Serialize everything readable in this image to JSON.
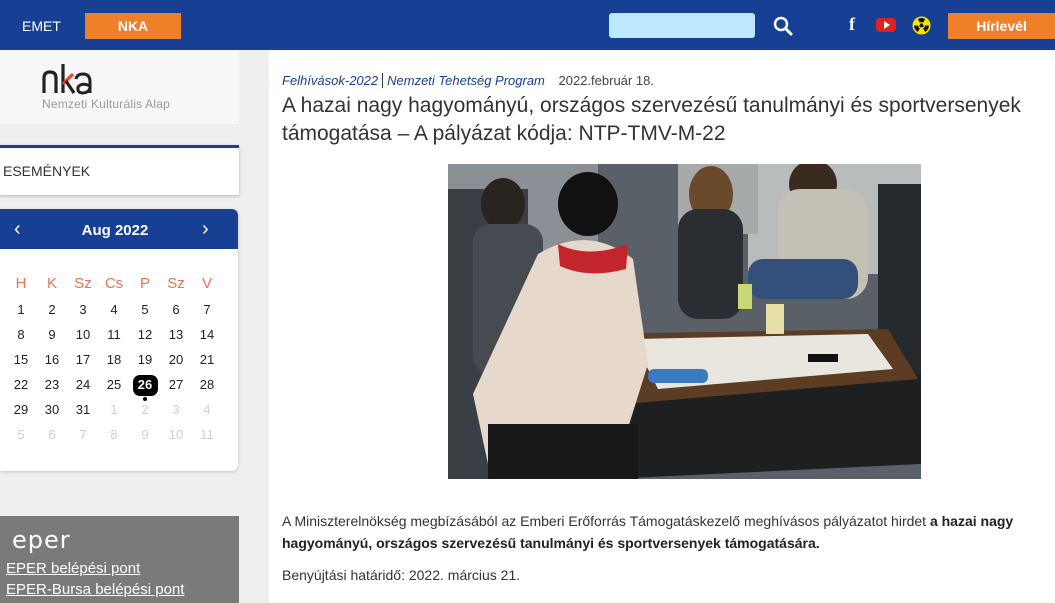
{
  "topbar": {
    "emet_label": "EMET",
    "nka_label": "NKA",
    "search_placeholder": "",
    "facebook_glyph": "f",
    "hirlevel_label": "Hírlevél",
    "colors": {
      "bar": "#173f93",
      "accent": "#f07f2a",
      "search": "#bde7fb"
    },
    "icons": [
      "search-icon",
      "facebook-icon",
      "youtube-icon",
      "radiation-icon"
    ]
  },
  "sidebar": {
    "logo_mark": "nka",
    "logo_text": "Nemzeti Kulturális Alap",
    "esemenyek_label": "ESEMÉNYEK",
    "calendar": {
      "prev_glyph": "‹",
      "next_glyph": "›",
      "month_label": "Aug 2022",
      "weekdays": [
        "H",
        "K",
        "Sz",
        "Cs",
        "P",
        "Sz",
        "V"
      ],
      "weeks": [
        [
          "1",
          "2",
          "3",
          "4",
          "5",
          "6",
          "7"
        ],
        [
          "8",
          "9",
          "10",
          "11",
          "12",
          "13",
          "14"
        ],
        [
          "15",
          "16",
          "17",
          "18",
          "19",
          "20",
          "21"
        ],
        [
          "22",
          "23",
          "24",
          "25",
          "26",
          "27",
          "28"
        ],
        [
          "29",
          "30",
          "31",
          "1",
          "2",
          "3",
          "4"
        ],
        [
          "5",
          "6",
          "7",
          "8",
          "9",
          "10",
          "11"
        ]
      ],
      "today": "26"
    },
    "eper": {
      "logo": "eper",
      "links": [
        "EPER belépési pont",
        "EPER-Bursa belépési pont"
      ]
    }
  },
  "article": {
    "breadcrumb": [
      "Felhívások-2022",
      "Nemzeti Tehetség Program"
    ],
    "date": "2022.február 18.",
    "title": "A hazai nagy hagyományú, országos szervezésű tanulmányi és sportversenyek támogatása – A pályázat kódja: NTP-TMV-M-22",
    "intro_plain": "A Miniszterelnökség megbízásából az Emberi Erőforrás Támogatáskezelő meghívásos pályázatot hirdet ",
    "intro_bold": "a hazai nagy hagyományú, országos szervezésű tanulmányi és sportversenyek támogatására.",
    "deadline": "Benyújtási határidő: 2022. március 21."
  }
}
